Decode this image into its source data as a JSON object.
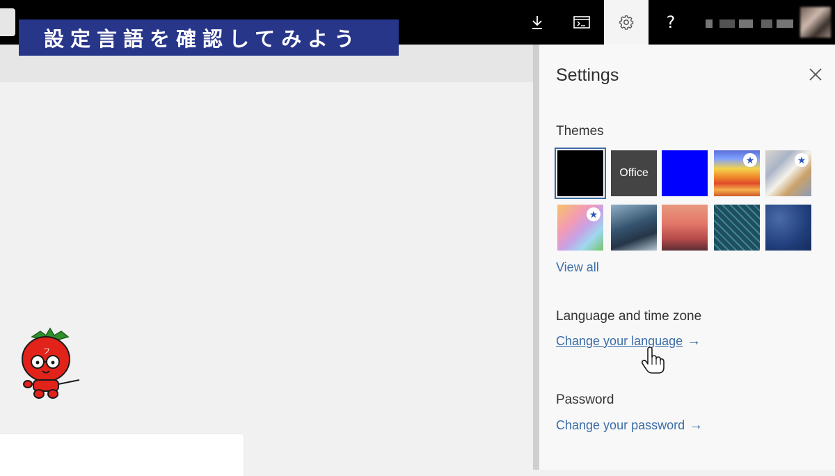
{
  "banner": {
    "text": "設定言語を確認してみよう"
  },
  "topbar": {
    "icons": {
      "download": "download-icon",
      "console": "console-icon",
      "settings": "gear-icon",
      "help": "help-icon"
    },
    "help_glyph": "?"
  },
  "settings_panel": {
    "title": "Settings",
    "themes": {
      "heading": "Themes",
      "swatches": [
        {
          "name": "black",
          "label": "",
          "color": "#000000",
          "selected": true
        },
        {
          "name": "office",
          "label": "Office",
          "color": "#444444"
        },
        {
          "name": "blue",
          "label": "",
          "color": "#0000ff"
        },
        {
          "name": "rainbow",
          "label": "",
          "premium": true
        },
        {
          "name": "silver-wave",
          "label": "",
          "premium": true
        },
        {
          "name": "unicorn",
          "label": "",
          "premium": true
        },
        {
          "name": "mountain",
          "label": ""
        },
        {
          "name": "palm-sunset",
          "label": ""
        },
        {
          "name": "circuit",
          "label": ""
        },
        {
          "name": "innovation",
          "label": ""
        }
      ],
      "view_all": "View all"
    },
    "language": {
      "heading": "Language and time zone",
      "link": "Change your language"
    },
    "password": {
      "heading": "Password",
      "link": "Change your password"
    },
    "link_arrow": "→",
    "star_glyph": "★"
  },
  "colors": {
    "topbar": "#000000",
    "banner": "#28368a",
    "link": "#3c6da8",
    "panel_bg": "#f8f8f8",
    "main_bg": "#f1f1f1"
  }
}
